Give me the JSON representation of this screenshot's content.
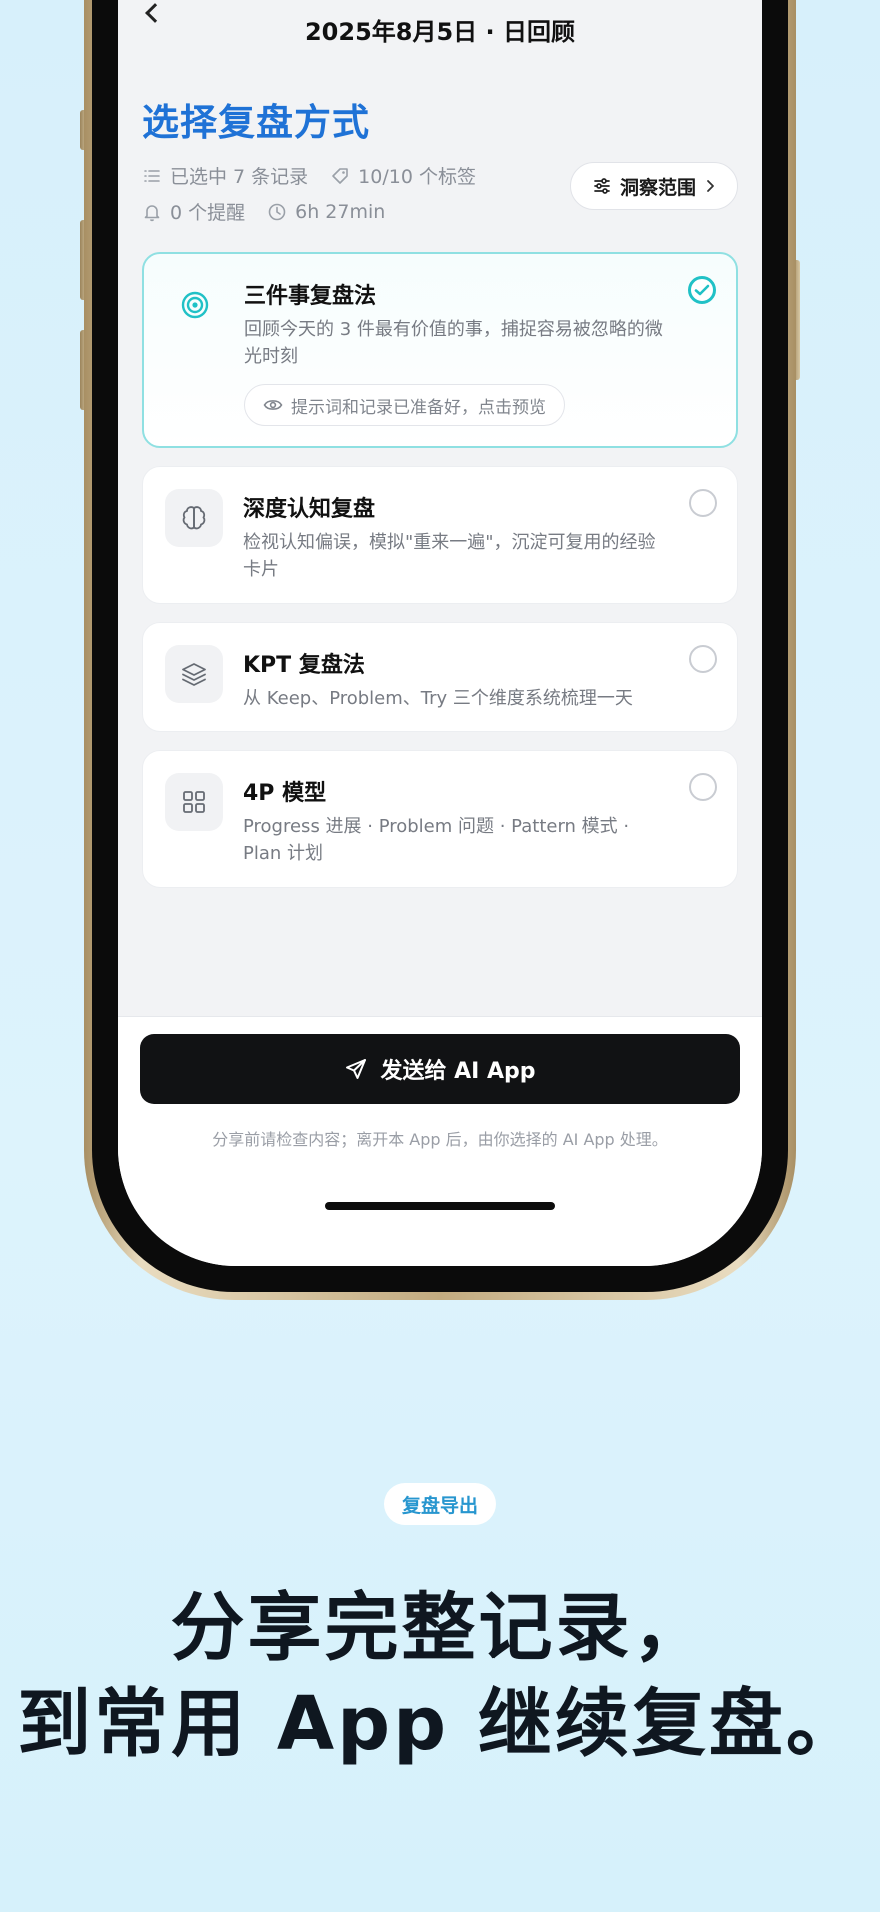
{
  "nav": {
    "title": "2025年8月5日 · 日回顾"
  },
  "page": {
    "title": "选择复盘方式",
    "meta": {
      "selected_records": "已选中 7 条记录",
      "tags": "10/10 个标签",
      "reminders": "0 个提醒",
      "duration": "6h 27min"
    },
    "scope_button": "洞察范围"
  },
  "methods": [
    {
      "title": "三件事复盘法",
      "desc": "回顾今天的 3 件最有价值的事，捕捉容易被忽略的微光时刻",
      "preview": "提示词和记录已准备好，点击预览",
      "icon": "target-icon",
      "selected": true
    },
    {
      "title": "深度认知复盘",
      "desc": "检视认知偏误，模拟\"重来一遍\"，沉淀可复用的经验卡片",
      "icon": "brain-icon",
      "selected": false
    },
    {
      "title": "KPT 复盘法",
      "desc": "从 Keep、Problem、Try 三个维度系统梳理一天",
      "icon": "layers-icon",
      "selected": false
    },
    {
      "title": "4P 模型",
      "desc": "Progress 进展 · Problem 问题 · Pattern 模式 · Plan 计划",
      "icon": "grid-icon",
      "selected": false
    }
  ],
  "bottom": {
    "send_label": "发送给 AI App",
    "note": "分享前请检查内容；离开本 App 后，由你选择的 AI App 处理。"
  },
  "marketing": {
    "badge": "复盘导出",
    "headline_1": "分享完整记录，",
    "headline_2": "到常用 App 继续复盘。"
  },
  "colors": {
    "accent_blue": "#1f72d6",
    "accent_teal": "#20c1c6",
    "background": "#d7f0fb"
  }
}
